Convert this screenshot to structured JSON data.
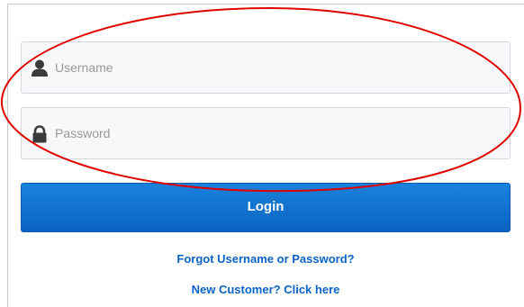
{
  "login_form": {
    "username": {
      "placeholder": "Username",
      "value": "",
      "icon": "user-icon"
    },
    "password": {
      "placeholder": "Password",
      "value": "",
      "icon": "lock-icon"
    },
    "login_label": "Login",
    "forgot_link": "Forgot Username or Password?",
    "new_customer_link": "New Customer? Click here"
  },
  "colors": {
    "button": "#0b64c2",
    "link": "#0b63c5",
    "annotation": "#e00000",
    "field_background": "#f7f8fa"
  }
}
